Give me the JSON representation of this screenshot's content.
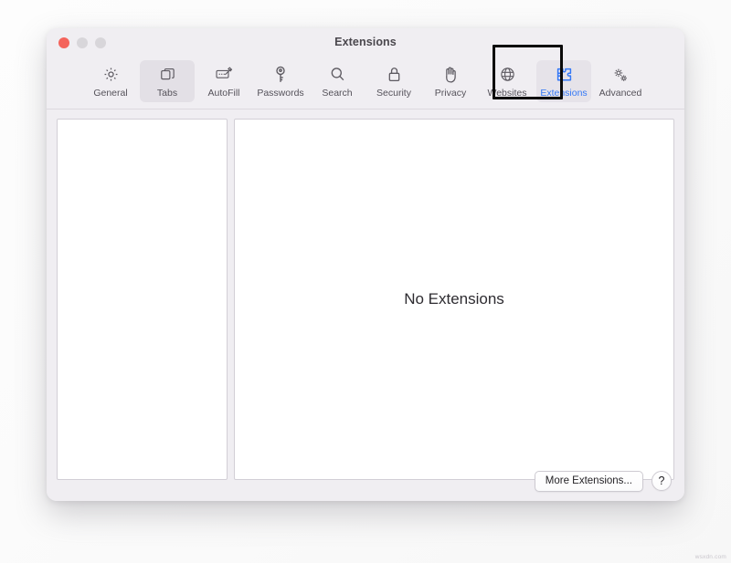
{
  "window": {
    "title": "Extensions",
    "traffic_lights": [
      {
        "name": "close",
        "color": "#f4645c"
      },
      {
        "name": "minimize",
        "color": "#d8d6da"
      },
      {
        "name": "maximize",
        "color": "#d8d6da"
      }
    ]
  },
  "toolbar": {
    "items": [
      {
        "label": "General",
        "icon": "gear-icon",
        "state": "normal"
      },
      {
        "label": "Tabs",
        "icon": "tabs-icon",
        "state": "hovered"
      },
      {
        "label": "AutoFill",
        "icon": "autofill-icon",
        "state": "normal"
      },
      {
        "label": "Passwords",
        "icon": "key-icon",
        "state": "normal"
      },
      {
        "label": "Search",
        "icon": "magnifier-icon",
        "state": "normal"
      },
      {
        "label": "Security",
        "icon": "lock-icon",
        "state": "normal"
      },
      {
        "label": "Privacy",
        "icon": "hand-icon",
        "state": "normal"
      },
      {
        "label": "Websites",
        "icon": "globe-icon",
        "state": "normal"
      },
      {
        "label": "Extensions",
        "icon": "puzzle-icon",
        "state": "selected"
      },
      {
        "label": "Advanced",
        "icon": "gears-icon",
        "state": "normal"
      }
    ],
    "accent_color": "#3478f6",
    "annotation": {
      "target": "Extensions",
      "shape": "rectangle",
      "color": "#0a0a0a"
    }
  },
  "main": {
    "left_panel": {
      "items": []
    },
    "detail_panel": {
      "empty_message": "No Extensions"
    }
  },
  "footer": {
    "more_extensions_label": "More Extensions...",
    "help_label": "?"
  },
  "watermark": "wsxdn.com"
}
